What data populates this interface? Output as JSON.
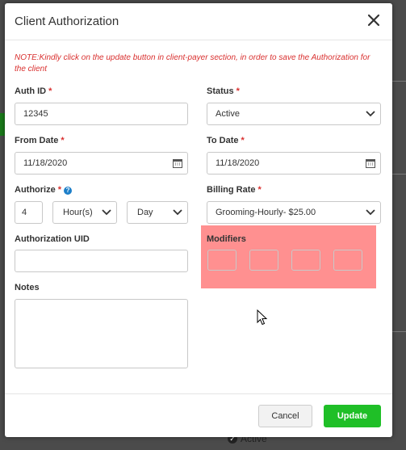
{
  "modal": {
    "title": "Client Authorization",
    "note": "NOTE:Kindly click on the update button in client-payer section, in order to save the Authorization for the client"
  },
  "form": {
    "auth_id": {
      "label": "Auth ID",
      "value": "12345"
    },
    "status": {
      "label": "Status",
      "value": "Active"
    },
    "from_date": {
      "label": "From Date",
      "value": "11/18/2020"
    },
    "to_date": {
      "label": "To Date",
      "value": "11/18/2020"
    },
    "authorize": {
      "label": "Authorize",
      "amount": "4",
      "unit": "Hour(s)",
      "period": "Day"
    },
    "billing_rate": {
      "label": "Billing Rate",
      "value": "Grooming-Hourly- $25.00"
    },
    "authorization_uid": {
      "label": "Authorization UID",
      "value": ""
    },
    "modifiers": {
      "label": "Modifiers",
      "values": [
        "",
        "",
        "",
        ""
      ]
    },
    "notes": {
      "label": "Notes",
      "value": ""
    },
    "required_mark": "*"
  },
  "footer": {
    "cancel_label": "Cancel",
    "update_label": "Update"
  },
  "background": {
    "status_text": "Active"
  },
  "colors": {
    "required": "#d9302f",
    "update_button": "#1fbf27",
    "modifiers_highlight": "#ff9090",
    "help_icon": "#1d7fc9"
  },
  "icons": [
    "close-icon",
    "calendar-icon",
    "chevron-down-icon",
    "help-icon",
    "mouse-pointer-icon",
    "check-circle-icon"
  ]
}
